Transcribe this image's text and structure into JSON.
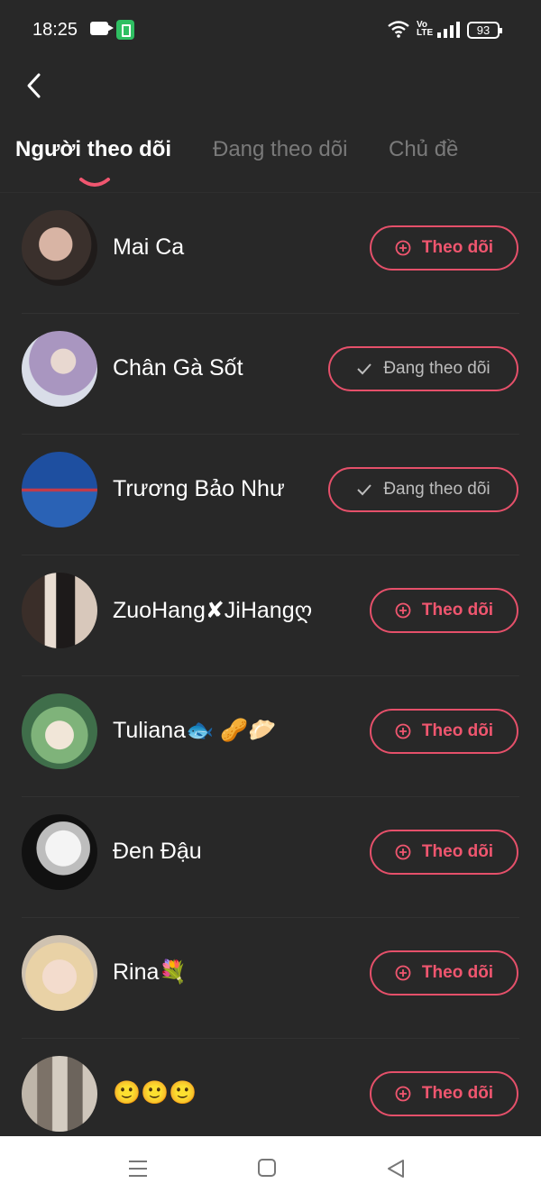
{
  "status_bar": {
    "time": "18:25",
    "battery_level": "93",
    "network_label": "Vo LTE"
  },
  "header": {
    "back_icon": "chevron-left-icon"
  },
  "tabs": [
    {
      "label": "Người theo dõi",
      "active": true
    },
    {
      "label": "Đang theo dõi",
      "active": false
    },
    {
      "label": "Chủ đề",
      "active": false
    }
  ],
  "list": [
    {
      "name": "Mai Ca",
      "button": "Theo dõi",
      "state": "follow",
      "avatar_color": "#6b5d57"
    },
    {
      "name": "Chân Gà Sốt",
      "button": "Đang theo dõi",
      "state": "following",
      "avatar_color": "#b9a6c9"
    },
    {
      "name": "Trương Bảo Như",
      "button": "Đang theo dõi",
      "state": "following",
      "avatar_color": "#2f5ea8"
    },
    {
      "name": "ZuoHang✘JiHangღ",
      "button": "Theo dõi",
      "state": "follow",
      "avatar_color": "#5d4a40"
    },
    {
      "name": "Tuliana🐟 🥜🥟",
      "button": "Theo dõi",
      "state": "follow",
      "avatar_color": "#7fa87a"
    },
    {
      "name": "Đen Đậu",
      "button": "Theo dõi",
      "state": "follow",
      "avatar_color": "#d9d9d9"
    },
    {
      "name": "Rina💐",
      "button": "Theo dõi",
      "state": "follow",
      "avatar_color": "#e6d2b8"
    },
    {
      "name": "🙂🙂🙂",
      "button": "Theo dõi",
      "state": "follow",
      "avatar_color": "#8a8278"
    }
  ],
  "nav_bar": {
    "icons": [
      "menu-icon",
      "home-square-icon",
      "back-triangle-icon"
    ]
  },
  "colors": {
    "background": "#282828",
    "accent": "#f0566f",
    "muted_text": "#7a7a7a"
  }
}
